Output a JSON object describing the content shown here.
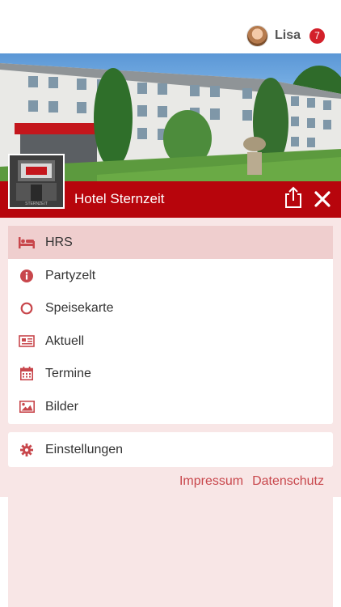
{
  "user": {
    "name": "Lisa",
    "notification_count": "7"
  },
  "hotel": {
    "name": "Hotel Sternzeit",
    "thumb_text": "STERNZEIT"
  },
  "menu": {
    "items": [
      {
        "label": "HRS",
        "icon": "bed-icon",
        "active": true
      },
      {
        "label": "Partyzelt",
        "icon": "info-icon",
        "active": false
      },
      {
        "label": "Speisekarte",
        "icon": "circle-icon",
        "active": false
      },
      {
        "label": "Aktuell",
        "icon": "newspaper-icon",
        "active": false
      },
      {
        "label": "Termine",
        "icon": "calendar-icon",
        "active": false
      },
      {
        "label": "Bilder",
        "icon": "image-icon",
        "active": false
      }
    ],
    "settings": {
      "label": "Einstellungen",
      "icon": "gear-icon"
    }
  },
  "footer": {
    "impressum": "Impressum",
    "datenschutz": "Datenschutz"
  },
  "colors": {
    "brand_red": "#b7050c",
    "icon_red": "#c8474c",
    "panel_bg": "#f8e6e6",
    "active_bg": "#efcece",
    "badge_red": "#d3202a"
  }
}
